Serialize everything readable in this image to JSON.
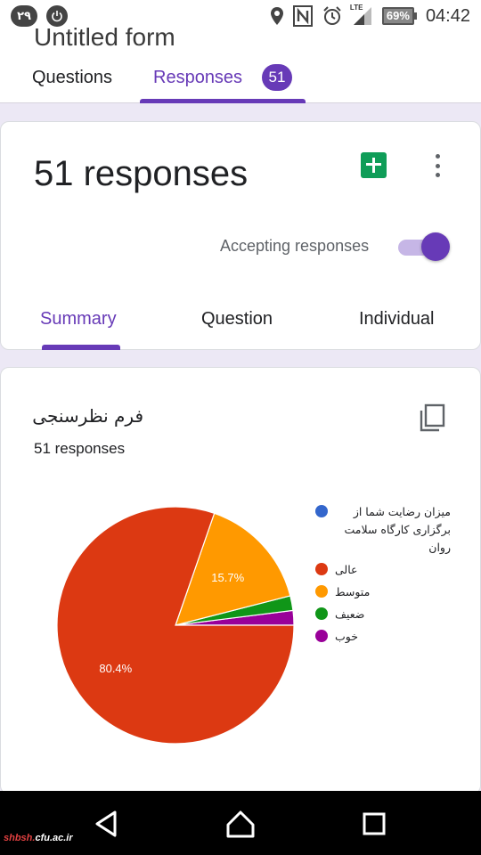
{
  "status_bar": {
    "notification_count": "۲۹",
    "battery": "69%",
    "network": "LTE",
    "time": "04:42"
  },
  "header": {
    "form_title": "Untitled form",
    "tabs": [
      {
        "label": "Questions",
        "active": false
      },
      {
        "label": "Responses",
        "active": true,
        "badge": "51"
      }
    ]
  },
  "summary_card": {
    "title": "51 responses",
    "accepting_label": "Accepting responses",
    "accepting_on": true,
    "sub_tabs": [
      {
        "label": "Summary",
        "active": true
      },
      {
        "label": "Question",
        "active": false
      },
      {
        "label": "Individual",
        "active": false
      }
    ]
  },
  "question_card": {
    "title": "فرم نظرسنجی",
    "response_count": "51 responses"
  },
  "chart_data": {
    "type": "pie",
    "labels": [
      "میزان رضایت شما از برگزاری کارگاه سلامت روان",
      "عالی",
      "متوسط",
      "ضعیف",
      "خوب"
    ],
    "values": [
      0,
      80.4,
      15.7,
      2.0,
      2.0
    ],
    "colors": [
      "#3366cc",
      "#dc3912",
      "#ff9900",
      "#109618",
      "#990099"
    ],
    "data_labels": [
      "",
      "80.4%",
      "15.7%",
      "",
      ""
    ],
    "legend_position": "right"
  },
  "nav_bar": {
    "watermark_red": "shbsh.",
    "watermark_white": "cfu.ac.ir"
  }
}
